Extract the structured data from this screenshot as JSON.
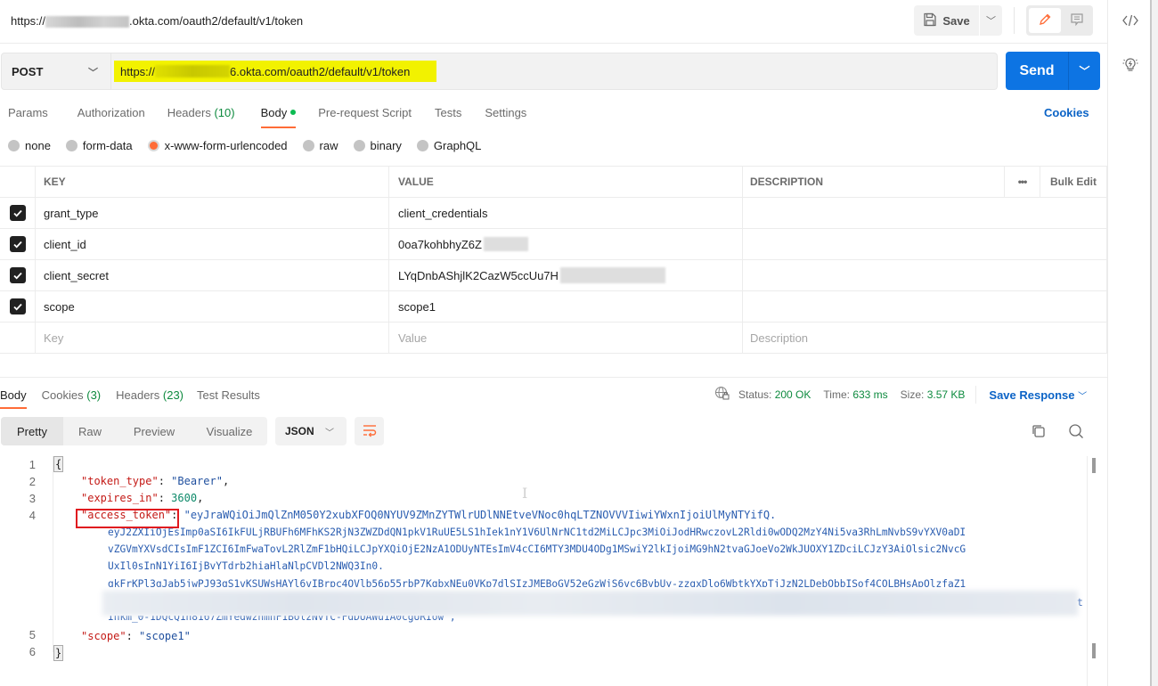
{
  "header": {
    "request_title_prefix": "https://",
    "request_title_suffix": ".okta.com/oauth2/default/v1/token",
    "save_label": "Save",
    "save_icon": "floppy-disk-icon",
    "edit_icon": "pencil-icon",
    "comment_icon": "comment-icon"
  },
  "request": {
    "method": "POST",
    "url_prefix": "https://",
    "url_suffix": "6.okta.com/oauth2/default/v1/token",
    "send_label": "Send",
    "highlight_color": "#f2f200"
  },
  "request_tabs": [
    {
      "label": "Params"
    },
    {
      "label": "Authorization"
    },
    {
      "label": "Headers",
      "count": "(10)"
    },
    {
      "label": "Body",
      "active": true,
      "indicator": "green-dot"
    },
    {
      "label": "Pre-request Script"
    },
    {
      "label": "Tests"
    },
    {
      "label": "Settings"
    }
  ],
  "cookies_link": "Cookies",
  "body_types": [
    {
      "label": "none",
      "selected": false
    },
    {
      "label": "form-data",
      "selected": false
    },
    {
      "label": "x-www-form-urlencoded",
      "selected": true
    },
    {
      "label": "raw",
      "selected": false
    },
    {
      "label": "binary",
      "selected": false
    },
    {
      "label": "GraphQL",
      "selected": false
    }
  ],
  "params_table": {
    "columns": [
      "KEY",
      "VALUE",
      "DESCRIPTION"
    ],
    "more_label": "•••",
    "bulk_edit_label": "Bulk Edit",
    "rows": [
      {
        "checked": true,
        "key": "grant_type",
        "value": "client_credentials",
        "description": ""
      },
      {
        "checked": true,
        "key": "client_id",
        "value": "0oa7kohbhyZ6Z",
        "description": ""
      },
      {
        "checked": true,
        "key": "client_secret",
        "value": "LYqDnbAShjlK2CazW5ccUu7H",
        "description": ""
      },
      {
        "checked": true,
        "key": "scope",
        "value": "scope1",
        "description": ""
      }
    ],
    "placeholders": {
      "key": "Key",
      "value": "Value",
      "description": "Description"
    }
  },
  "response": {
    "tabs": [
      {
        "label": "Body",
        "active": true
      },
      {
        "label": "Cookies",
        "count": "(3)"
      },
      {
        "label": "Headers",
        "count": "(23)"
      },
      {
        "label": "Test Results"
      }
    ],
    "status_label": "Status:",
    "status_value": "200 OK",
    "time_label": "Time:",
    "time_value": "633 ms",
    "size_label": "Size:",
    "size_value": "3.57 KB",
    "save_response_label": "Save Response",
    "view_modes": [
      "Pretty",
      "Raw",
      "Preview",
      "Visualize"
    ],
    "active_view": "Pretty",
    "format": "JSON",
    "body_lines": {
      "l1": "{",
      "l2_key": "\"token_type\"",
      "l2_val": "\"Bearer\"",
      "l3_key": "\"expires_in\"",
      "l3_val": "3600",
      "l4_key": "\"access_token\"",
      "l4_val_a": "\"eyJraWQiOiJmQlZnM050Y2xubXFOQ0NYUV9ZMnZYTWlrUDlNNEtveVNoc0hqLTZNOVVVIiwiYWxnIjoiUlMyNTYifQ.",
      "l4_val_b": "eyJ2ZXIiOjEsImp0aSI6IkFULjRBUFh6MFhKS2RjN3ZWZDdQN1pkV1RuUE5LS1hIek1nY1V6UlNrNC1td2MiLCJpc3MiOiJodHRwczovL2Rldi0wODQ2MzY4Ni5va3RhLmNvbS9vYXV0aDI",
      "l4_val_c": "vZGVmYXVsdCIsImF1ZCI6ImFwaTovL2RlZmF1bHQiLCJpYXQiOjE2NzA1ODUyNTEsImV4cCI6MTY3MDU4ODg1MSwiY2lkIjoiMG9hN2tvaGJoeVo2WkJUOXY1ZDciLCJzY3AiOlsic2NvcG",
      "l4_val_d": "UxIl0sInN1YiI6IjBvYTdrb2hiaHlaNlpCVDl2NWQ3In0.",
      "l4_val_e": "gkFrKPl3qJab5jwPJ93gS1vKSUWsHAYl6vIBrpc4OVlb56p55rbP7KgbxNEu0VKp7dlSIzJMEBoGV52eGzWjS6vc6BvbUy-zzgxDlo6WbtkYXpTjJzN2LDebObbISof4COLBHsApOlzfaZ1",
      "l4_val_f": "t",
      "l4_val_g": "Inkm_0-1DQcQ1n8167ZmYedwznmnF1BolzNvTC-FdDUAWu1A0cgURIow\",",
      "l5_key": "\"scope\"",
      "l5_val": "\"scope1\"",
      "l6": "}"
    },
    "line_numbers": [
      "1",
      "2",
      "3",
      "4",
      "5",
      "6"
    ]
  },
  "right_sidebar": {
    "code_icon": "code-icon",
    "bulb_icon": "lightbulb-icon"
  }
}
